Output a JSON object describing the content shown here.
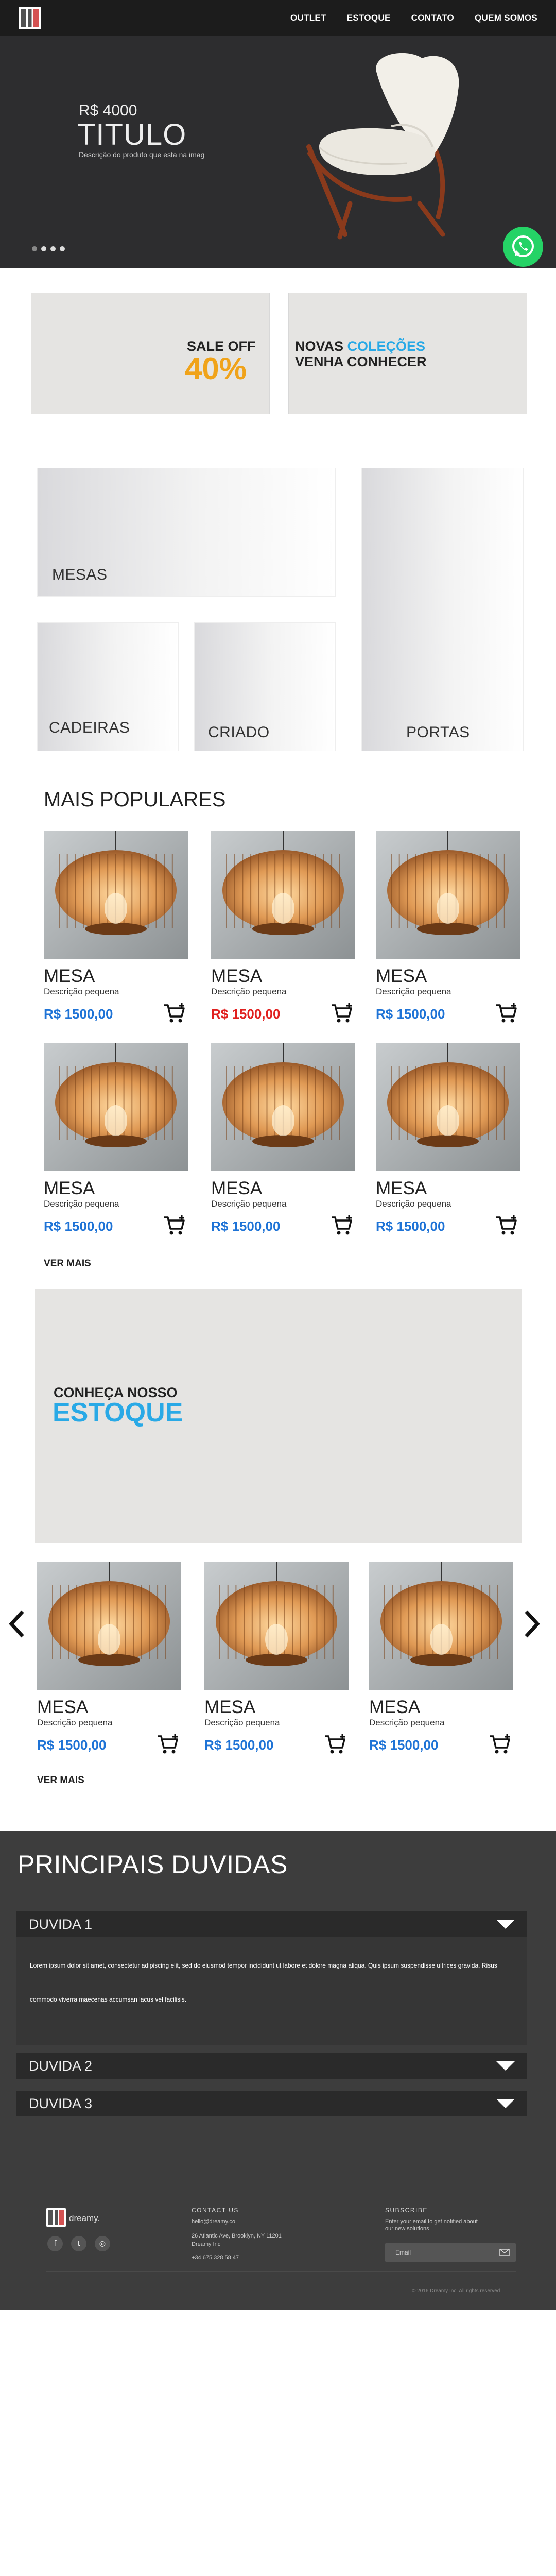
{
  "nav": {
    "items": [
      "OUTLET",
      "ESTOQUE",
      "CONTATO",
      "QUEM SOMOS"
    ]
  },
  "hero": {
    "price": "R$ 4000",
    "title": "TITULO",
    "description": "Descrição do produto que esta na imag",
    "slides": 4,
    "active_slide": 0
  },
  "promos": {
    "sale_top": "SALE OFF",
    "sale_pct": "40%",
    "novas": "NOVAS",
    "colecoes": "COLEÇÕES",
    "venha": "VENHA CONHECER"
  },
  "categories": {
    "mesas": "MESAS",
    "cadeiras": "CADEIRAS",
    "criado": "CRIADO",
    "portas": "PORTAS"
  },
  "popular": {
    "heading": "MAIS POPULARES",
    "products": [
      {
        "name": "MESA",
        "desc": "Descrição pequena",
        "price": "R$ 1500,00"
      },
      {
        "name": "MESA",
        "desc": "Descrição pequena",
        "price": "R$ 1500,00"
      },
      {
        "name": "MESA",
        "desc": "Descrição pequena",
        "price": "R$ 1500,00"
      },
      {
        "name": "MESA",
        "desc": "Descrição pequena",
        "price": "R$ 1500,00"
      },
      {
        "name": "MESA",
        "desc": "Descrição pequena",
        "price": "R$ 1500,00"
      },
      {
        "name": "MESA",
        "desc": "Descrição pequena",
        "price": "R$ 1500,00"
      }
    ],
    "ver_mais": "VER MAIS"
  },
  "stock": {
    "conheca": "CONHEÇA NOSSO",
    "estoque": "ESTOQUE",
    "products": [
      {
        "name": "MESA",
        "desc": "Descrição pequena",
        "price": "R$ 1500,00"
      },
      {
        "name": "MESA",
        "desc": "Descrição pequena",
        "price": "R$ 1500,00"
      },
      {
        "name": "MESA",
        "desc": "Descrição pequena",
        "price": "R$ 1500,00"
      }
    ],
    "ver_mais": "VER MAIS"
  },
  "faq": {
    "heading": "PRINCIPAIS DUVIDAS",
    "items": [
      {
        "title": "DUVIDA 1",
        "body1": "Lorem ipsum dolor sit amet, consectetur adipiscing elit, sed do eiusmod tempor incididunt ut labore et dolore magna aliqua. Quis ipsum suspendisse ultrices gravida. Risus",
        "body2": "commodo viverra maecenas accumsan lacus vel facilisis."
      },
      {
        "title": "DUVIDA 2"
      },
      {
        "title": "DUVIDA 3"
      }
    ]
  },
  "footer": {
    "brand": "dreamy.",
    "contact_heading": "CONTACT US",
    "email": "hello@dreamy.co",
    "address": "26 Atlantic Ave, Brooklyn, NY 11201",
    "company": "Dreamy Inc",
    "phone": "+34 675 328 58 47",
    "subscribe_heading": "SUBSCRIBE",
    "subscribe_text1": "Enter your email to get notified about",
    "subscribe_text2": "our new solutions",
    "email_placeholder": "Email",
    "copyright": "© 2016 Dreamy Inc. All rights reserved"
  },
  "colors": {
    "accent_blue": "#1e73d6",
    "sale_orange": "#f0a31a",
    "sale_red_price": "#e0201f",
    "cyan": "#29a9e6",
    "whatsapp": "#25d366"
  }
}
